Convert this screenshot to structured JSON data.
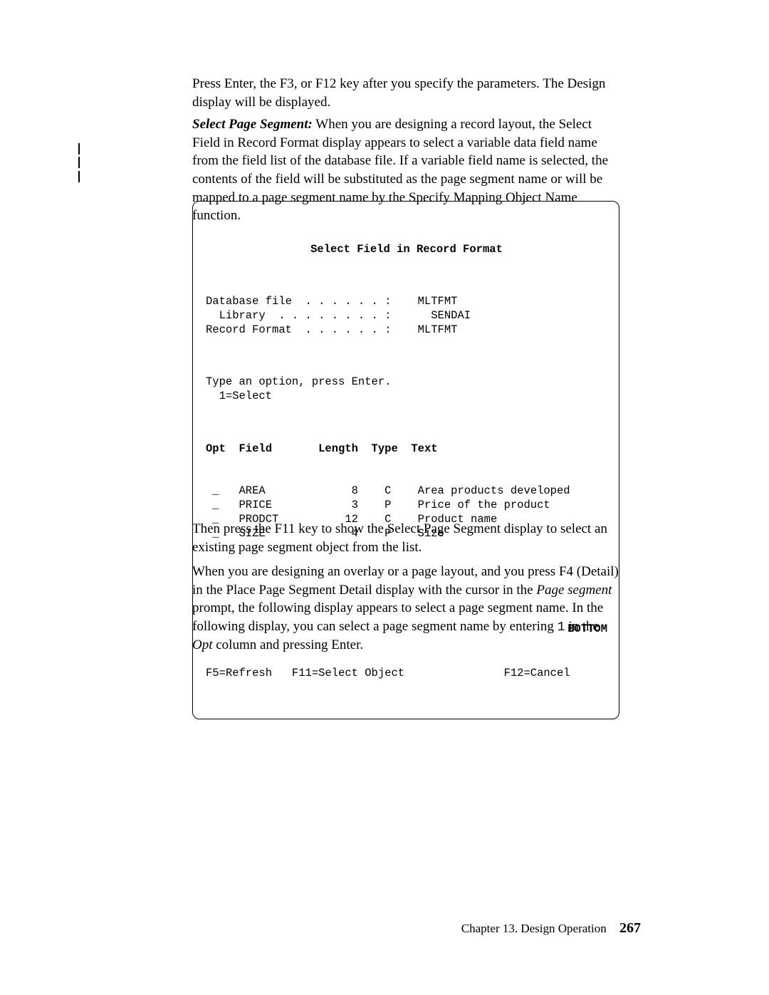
{
  "paragraphs": {
    "p1": "Press Enter, the F3, or F12 key after you specify the parameters.  The Design display will be displayed.",
    "p2_label": "Select Page Segment:",
    "p2_body": "  When you are designing a record layout, the Select Field in Record Format display appears to select a variable data field name from the field list of the database file.  If a variable field name is selected, the contents of the field will be substituted as the page segment name or will be mapped to a page segment name by the Specify Mapping Object Name function.",
    "p3": "Then press the F11 key to show the Select Page Segment display to select an existing page segment object from the list.",
    "p4_a": "When you are designing an overlay or a page layout, and you press F4 (Detail) in the Place Page Segment Detail display with the cursor in the ",
    "p4_ital1": "Page segment",
    "p4_b": " prompt, the following display appears to select a page segment name.  In the following display, you can select a page segment name by entering ",
    "p4_mono": "1",
    "p4_c": " in the ",
    "p4_ital2": "Opt",
    "p4_d": " column and pressing Enter."
  },
  "screen": {
    "title": "Select Field in Record Format",
    "headerLines": "Database file  . . . . . . :    MLTFMT\n  Library  . . . . . . . . :      SENDAI\nRecord Format  . . . . . . :    MLTFMT",
    "prompt": "Type an option, press Enter.\n  1=Select",
    "colHeaders": "Opt  Field       Length  Type  Text",
    "rows": " _   AREA             8    C    Area products developed\n _   PRICE            3    P    Price of the product\n _   PRODCT          12    C    Product name\n _   SIZE             4    P    Size",
    "bottomLabel": "BOTTOM",
    "fkeys": "F5=Refresh   F11=Select Object               F12=Cancel"
  },
  "footer": {
    "chapter": "Chapter 13.  Design Operation",
    "pageNumber": "267"
  }
}
